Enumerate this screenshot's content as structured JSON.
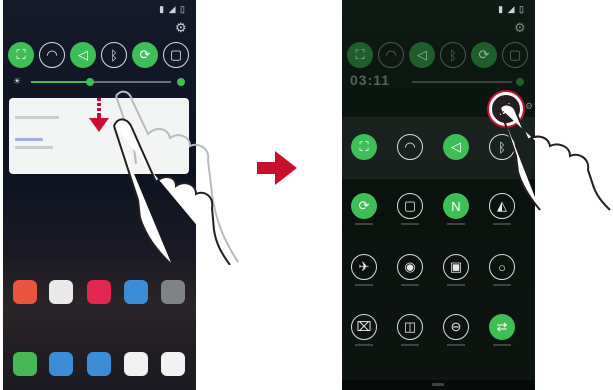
{
  "left_phone": {
    "status_icons": "▮ ◢ ▯",
    "quick_tiles": [
      {
        "icon": "screen-capture-icon",
        "glyph": "⛶",
        "state": "on"
      },
      {
        "icon": "wifi-icon",
        "glyph": "◠",
        "state": "off"
      },
      {
        "icon": "sound-icon",
        "glyph": "◁",
        "state": "on"
      },
      {
        "icon": "bluetooth-icon",
        "glyph": "ᛒ",
        "state": "off"
      },
      {
        "icon": "rotate-icon",
        "glyph": "⟳",
        "state": "on"
      },
      {
        "icon": "nfc-icon",
        "glyph": "▢",
        "state": "off"
      }
    ],
    "brightness_level": 0.42
  },
  "right_phone": {
    "status_icons": "▮ ◢ ▯",
    "time": "03:11",
    "top_tiles": [
      {
        "icon": "screen-capture-icon",
        "glyph": "⛶",
        "state": "on"
      },
      {
        "icon": "wifi-icon",
        "glyph": "◠",
        "state": "off"
      },
      {
        "icon": "sound-icon",
        "glyph": "◁",
        "state": "on"
      },
      {
        "icon": "bluetooth-icon",
        "glyph": "ᛒ",
        "state": "off"
      }
    ],
    "grid_tiles": [
      {
        "icon": "rotate-icon",
        "glyph": "⟳",
        "state": "on"
      },
      {
        "icon": "no-sim-icon",
        "glyph": "▢",
        "state": "off"
      },
      {
        "icon": "nfc-icon",
        "glyph": "N",
        "state": "on"
      },
      {
        "icon": "flashlight-icon",
        "glyph": "◭",
        "state": "off"
      },
      {
        "icon": "airplane-icon",
        "glyph": "✈",
        "state": "off"
      },
      {
        "icon": "hotspot-icon",
        "glyph": "◉",
        "state": "off"
      },
      {
        "icon": "battery-saver-icon",
        "glyph": "▣",
        "state": "off"
      },
      {
        "icon": "ring-icon",
        "glyph": "○",
        "state": "off"
      },
      {
        "icon": "mute-icon",
        "glyph": "⌧",
        "state": "off"
      },
      {
        "icon": "dual-window-icon",
        "glyph": "◫",
        "state": "off"
      },
      {
        "icon": "dnd-icon",
        "glyph": "⊖",
        "state": "off"
      },
      {
        "icon": "sync-icon",
        "glyph": "⇄",
        "state": "on"
      }
    ]
  },
  "colors": {
    "accent": "#3dbf56",
    "arrow": "#c8102e"
  }
}
